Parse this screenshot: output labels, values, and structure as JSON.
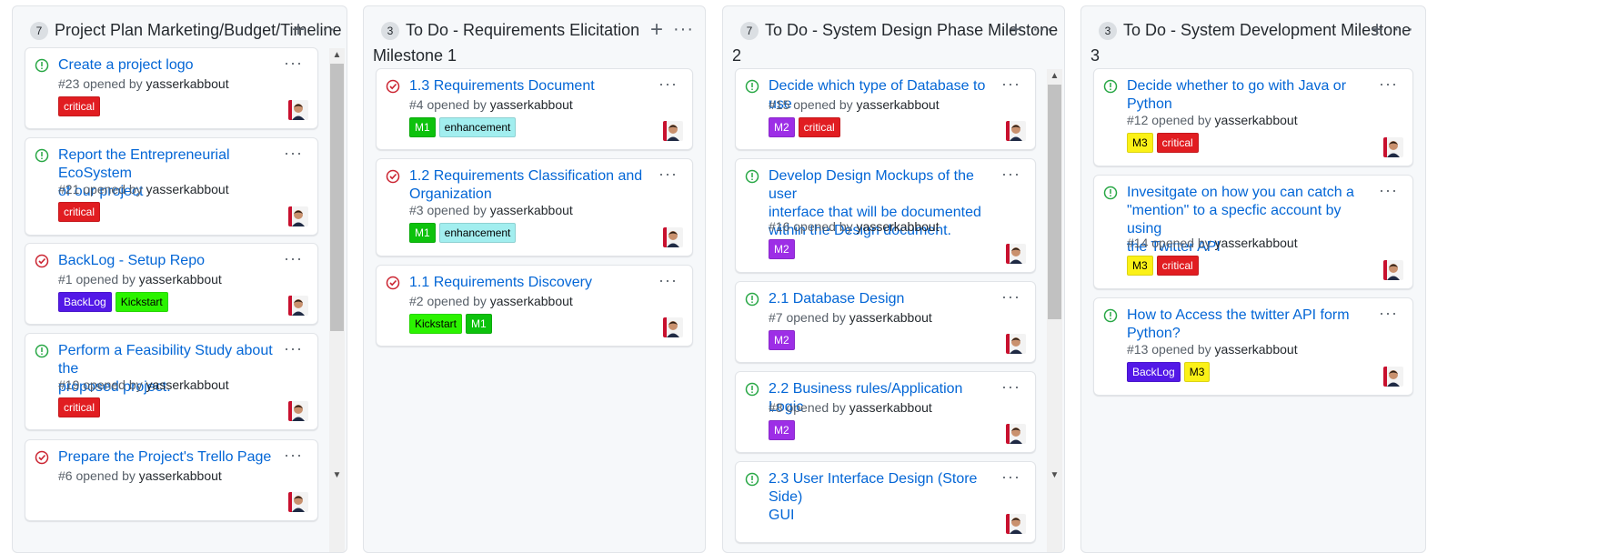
{
  "colors": {
    "critical": "#e11d21",
    "enhancement": "#a2eeef",
    "m1": "#0dc20d",
    "m2": "#9d2ee6",
    "m3": "#fbf117",
    "backlog": "#5319e7",
    "kickstart": "#2bf300",
    "open_icon": "#28a745",
    "closed_icon": "#cb2431",
    "link": "#0366d6"
  },
  "columns": [
    {
      "count": "7",
      "title": "Project Plan Marketing/Budget/Timeline",
      "title_line2": "",
      "add_icon": "plus-icon",
      "more_icon": "kebab-icon",
      "cards": [
        {
          "state": "open",
          "title": [
            "Create a project logo"
          ],
          "meta_prefix": "#23 opened by ",
          "author": "yasserkabbout",
          "labels": [
            {
              "name": "critical",
              "color": "#e11d21"
            }
          ]
        },
        {
          "state": "open",
          "title": [
            "Report the Entrepreneurial EcoSystem",
            "of our project"
          ],
          "meta_prefix": "#21 opened by ",
          "author": "yasserkabbout",
          "labels": [
            {
              "name": "critical",
              "color": "#e11d21"
            }
          ]
        },
        {
          "state": "closed",
          "title": [
            "BackLog - Setup Repo"
          ],
          "meta_prefix": "#1 opened by ",
          "author": "yasserkabbout",
          "labels": [
            {
              "name": "BackLog",
              "color": "#5319e7"
            },
            {
              "name": "Kickstart",
              "color": "#2bf300"
            }
          ]
        },
        {
          "state": "open",
          "title": [
            "Perform a Feasibility Study about the",
            "proposed project."
          ],
          "meta_prefix": "#19 opened by ",
          "author": "yasserkabbout",
          "labels": [
            {
              "name": "critical",
              "color": "#e11d21"
            }
          ]
        },
        {
          "state": "closed",
          "title": [
            "Prepare the Project's Trello Page"
          ],
          "meta_prefix": "#6 opened by ",
          "author": "yasserkabbout",
          "labels": []
        }
      ]
    },
    {
      "count": "3",
      "title": "To Do - Requirements Elicitation",
      "title_line2": "Milestone 1",
      "add_icon": "plus-icon",
      "more_icon": "kebab-icon",
      "cards": [
        {
          "state": "closed",
          "title": [
            "1.3 Requirements Document"
          ],
          "meta_prefix": "#4 opened by ",
          "author": "yasserkabbout",
          "labels": [
            {
              "name": "M1",
              "color": "#0dc20d"
            },
            {
              "name": "enhancement",
              "color": "#a2eeef"
            }
          ]
        },
        {
          "state": "closed",
          "title": [
            "1.2 Requirements Classification and",
            "Organization"
          ],
          "meta_prefix": "#3 opened by ",
          "author": "yasserkabbout",
          "labels": [
            {
              "name": "M1",
              "color": "#0dc20d"
            },
            {
              "name": "enhancement",
              "color": "#a2eeef"
            }
          ]
        },
        {
          "state": "closed",
          "title": [
            "1.1 Requirements Discovery"
          ],
          "meta_prefix": "#2 opened by ",
          "author": "yasserkabbout",
          "labels": [
            {
              "name": "Kickstart",
              "color": "#2bf300"
            },
            {
              "name": "M1",
              "color": "#0dc20d"
            }
          ]
        }
      ]
    },
    {
      "count": "7",
      "title": "To Do - System Design Phase Milestone",
      "title_line2": "2",
      "add_icon": "plus-icon",
      "more_icon": "kebab-icon",
      "cards": [
        {
          "state": "open",
          "title": [
            "Decide which type of Database to use"
          ],
          "meta_prefix": "#15 opened by ",
          "author": "yasserkabbout",
          "labels": [
            {
              "name": "M2",
              "color": "#9d2ee6"
            },
            {
              "name": "critical",
              "color": "#e11d21"
            }
          ]
        },
        {
          "state": "open",
          "title": [
            "Develop Design Mockups of the user",
            "interface that will be documented",
            "within the Design document."
          ],
          "meta_prefix": "#16 opened by ",
          "author": "yasserkabbout",
          "labels": [
            {
              "name": "M2",
              "color": "#9d2ee6"
            }
          ]
        },
        {
          "state": "open",
          "title": [
            "2.1 Database Design"
          ],
          "meta_prefix": "#7 opened by ",
          "author": "yasserkabbout",
          "labels": [
            {
              "name": "M2",
              "color": "#9d2ee6"
            }
          ]
        },
        {
          "state": "open",
          "title": [
            "2.2 Business rules/Application Logic"
          ],
          "meta_prefix": "#8 opened by ",
          "author": "yasserkabbout",
          "labels": [
            {
              "name": "M2",
              "color": "#9d2ee6"
            }
          ]
        },
        {
          "state": "open",
          "title": [
            "2.3 User Interface Design (Store Side)",
            "GUI"
          ],
          "meta_prefix": "",
          "author": "",
          "labels": []
        }
      ]
    },
    {
      "count": "3",
      "title": "To Do - System Development Milestone",
      "title_line2": "3",
      "add_icon": "plus-icon",
      "more_icon": "kebab-icon",
      "cards": [
        {
          "state": "open",
          "title": [
            "Decide whether to go with Java or",
            "Python"
          ],
          "meta_prefix": "#12 opened by ",
          "author": "yasserkabbout",
          "labels": [
            {
              "name": "M3",
              "color": "#fbf117"
            },
            {
              "name": "critical",
              "color": "#e11d21"
            }
          ]
        },
        {
          "state": "open",
          "title": [
            "Invesitgate on how you can catch a",
            "\"mention\" to a specfic account by using",
            "the Twitter API"
          ],
          "meta_prefix": "#14 opened by ",
          "author": "yasserkabbout",
          "labels": [
            {
              "name": "M3",
              "color": "#fbf117"
            },
            {
              "name": "critical",
              "color": "#e11d21"
            }
          ]
        },
        {
          "state": "open",
          "title": [
            "How to Access the twitter API form",
            "Python?"
          ],
          "meta_prefix": "#13 opened by ",
          "author": "yasserkabbout",
          "labels": [
            {
              "name": "BackLog",
              "color": "#5319e7"
            },
            {
              "name": "M3",
              "color": "#fbf117"
            }
          ]
        }
      ]
    }
  ]
}
